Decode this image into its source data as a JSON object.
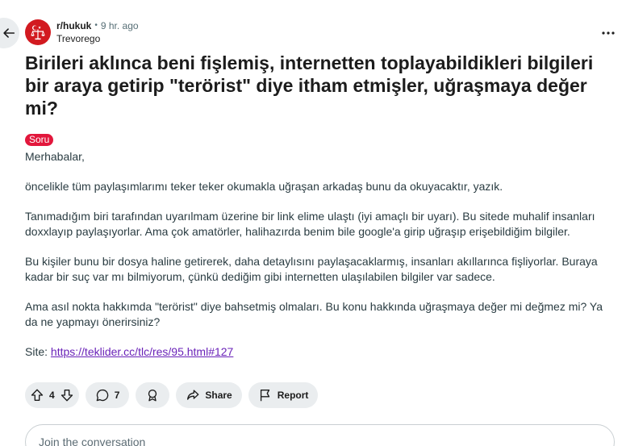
{
  "post": {
    "subreddit": "r/hukuk",
    "dot": "•",
    "time": "9 hr. ago",
    "author": "Trevorego",
    "title": "Birileri aklınca beni fişlemiş, internetten toplayabildikleri bilgileri bir araya getirip \"terörist\" diye itham etmişler, uğraşmaya değer mi?",
    "flair": "Soru",
    "body": {
      "p1": "Merhabalar,",
      "p2": "öncelikle tüm paylaşımlarımı teker teker okumakla uğraşan arkadaş bunu da okuyacaktır, yazık.",
      "p3": "Tanımadığım biri tarafından uyarılmam üzerine bir link elime ulaştı (iyi amaçlı bir uyarı). Bu sitede muhalif insanları doxxlayıp paylaşıyorlar. Ama çok amatörler, halihazırda benim bile google'a girip uğraşıp erişebildiğim bilgiler.",
      "p4": "Bu kişiler bunu bir dosya haline getirerek, daha detaylısını paylaşacaklarmış, insanları akıllarınca fişliyorlar. Buraya kadar bir suç var mı bilmiyorum, çünkü dediğim gibi internetten ulaşılabilen bilgiler var sadece.",
      "p5": "Ama asıl nokta hakkımda \"terörist\" diye bahsetmiş olmaları. Bu konu hakkında uğraşmaya değer mi değmez mi? Ya da ne yapmayı önerirsiniz?",
      "site_label": "Site:",
      "site_link": "https://teklider.cc/tlc/res/95.html#127"
    }
  },
  "actions": {
    "votes": "4",
    "comments": "7",
    "share": "Share",
    "report": "Report"
  },
  "comment_box": {
    "placeholder": "Join the conversation"
  },
  "icons": {
    "back": "arrow-left-icon",
    "more": "more-options-icon",
    "upvote": "upvote-icon",
    "downvote": "downvote-icon",
    "comment": "comment-icon",
    "award": "award-icon",
    "share": "share-icon",
    "report": "flag-icon"
  },
  "colors": {
    "flair_bg": "#e2173c",
    "avatar_bg": "#d21a20",
    "link": "#6a22b8",
    "pill_bg": "#eaedef"
  }
}
